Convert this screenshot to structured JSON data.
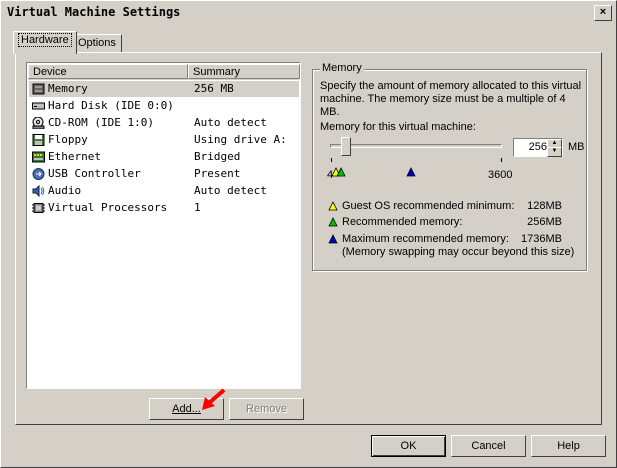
{
  "window": {
    "title": "Virtual Machine Settings",
    "close": "×"
  },
  "tabs": [
    {
      "label": "Hardware",
      "active": true
    },
    {
      "label": "Options",
      "active": false
    }
  ],
  "device_list": {
    "columns": [
      "Device",
      "Summary"
    ],
    "rows": [
      {
        "device": "Memory",
        "summary": "256 MB",
        "icon": "memory-icon",
        "selected": true
      },
      {
        "device": "Hard Disk (IDE 0:0)",
        "summary": "",
        "icon": "hard-disk-icon"
      },
      {
        "device": "CD-ROM (IDE 1:0)",
        "summary": "Auto detect",
        "icon": "cdrom-icon"
      },
      {
        "device": "Floppy",
        "summary": "Using drive A:",
        "icon": "floppy-icon"
      },
      {
        "device": "Ethernet",
        "summary": "Bridged",
        "icon": "ethernet-icon"
      },
      {
        "device": "USB Controller",
        "summary": "Present",
        "icon": "usb-icon"
      },
      {
        "device": "Audio",
        "summary": "Auto detect",
        "icon": "audio-icon"
      },
      {
        "device": "Virtual Processors",
        "summary": "1",
        "icon": "processor-icon"
      }
    ]
  },
  "buttons": {
    "add": "Add...",
    "remove": "Remove",
    "ok": "OK",
    "cancel": "Cancel",
    "help": "Help"
  },
  "memory": {
    "legend": "Memory",
    "description": "Specify the amount of memory allocated to this virtual machine. The memory size must be a multiple of 4 MB.",
    "label": "Memory for this virtual machine:",
    "value": "256",
    "unit": "MB",
    "slider_min": "4",
    "slider_max": "3600",
    "slider_value": 256,
    "markers": {
      "guest_min": {
        "label": "Guest OS recommended minimum:",
        "value": "128MB",
        "color": "#ffff00"
      },
      "recommended": {
        "label": "Recommended memory:",
        "value": "256MB",
        "color": "#00c000"
      },
      "maximum": {
        "label": "Maximum recommended memory:",
        "value": "1736MB",
        "color": "#0000c0"
      }
    },
    "swap_note": "(Memory swapping may occur beyond this size)"
  },
  "annotation_color": "#ff0000"
}
